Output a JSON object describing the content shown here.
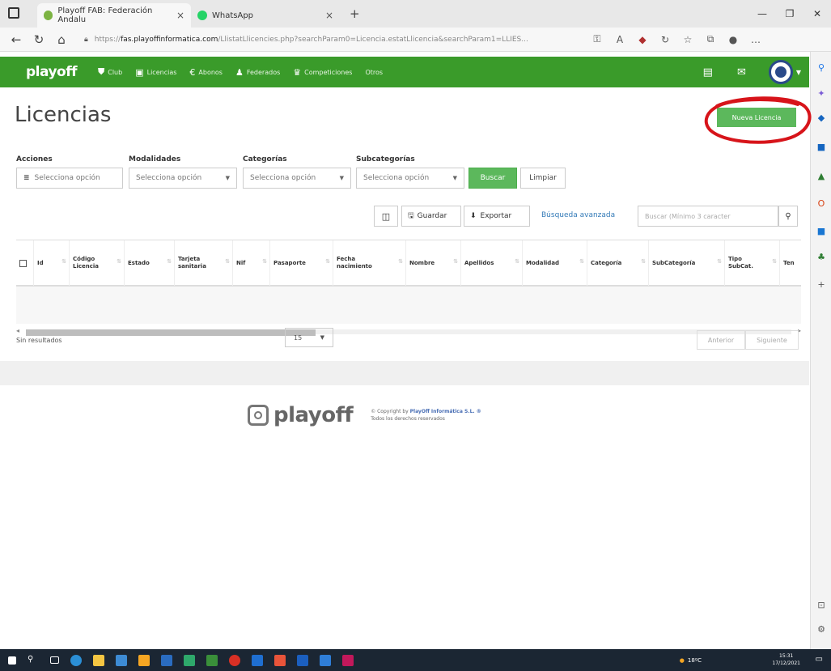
{
  "browser": {
    "tabs": [
      {
        "label": "Playoff FAB: Federación Andalu",
        "close": "×"
      },
      {
        "label": "WhatsApp",
        "close": "×"
      }
    ],
    "new_tab": "+",
    "url_prefix": "https://",
    "url_host": "fas.playoffinformatica.com",
    "url_path": "/LlistatLlicencies.php?searchParam0=Licencia.estatLlicencia&searchParam1=LLIES..."
  },
  "navbar": {
    "brand": "playoff",
    "items": [
      {
        "icon": "shield-icon",
        "label": "Club"
      },
      {
        "icon": "id-card-icon",
        "label": "Licencias"
      },
      {
        "icon": "euro-icon",
        "label": "Abonos"
      },
      {
        "icon": "person-icon",
        "label": "Federados"
      },
      {
        "icon": "trophy-icon",
        "label": "Competiciones"
      },
      {
        "icon": "",
        "label": "Otros"
      }
    ]
  },
  "page": {
    "title": "Licencias",
    "new_button": "Nueva Licencia"
  },
  "filters": {
    "acciones": {
      "label": "Acciones",
      "placeholder": "Selecciona opción"
    },
    "modalidades": {
      "label": "Modalidades",
      "placeholder": "Selecciona opción"
    },
    "categorias": {
      "label": "Categorías",
      "placeholder": "Selecciona opción"
    },
    "subcategorias": {
      "label": "Subcategorías",
      "placeholder": "Selecciona opción"
    },
    "buscar": "Buscar",
    "limpiar": "Limpiar"
  },
  "toolbar": {
    "guardar": "Guardar",
    "exportar": "Exportar",
    "busqueda_avanzada": "Búsqueda avanzada",
    "search_placeholder": "Buscar (Mínimo 3 caracter"
  },
  "table": {
    "columns": [
      "Id",
      "Código Licencia",
      "Estado",
      "Tarjeta sanitaria",
      "Nif",
      "Pasaporte",
      "Fecha nacimiento",
      "Nombre",
      "Apellidos",
      "Modalidad",
      "Categoría",
      "SubCategoría",
      "Tipo SubCat.",
      "Ten"
    ],
    "rows": []
  },
  "pagination": {
    "no_results": "Sin resultados",
    "page_size": "15",
    "prev": "Anterior",
    "next": "Siguiente"
  },
  "footer": {
    "logo": "playoff",
    "copyright_prefix": "© Copyright by ",
    "company": "PlayOff Informática S.L. ®",
    "rights": "Todos los derechos reservados"
  },
  "taskbar": {
    "weather": "18ºC",
    "time": "15:31",
    "date": "17/12/2021"
  },
  "colors": {
    "brand_green": "#3a9b2a",
    "button_green": "#5cb85c",
    "annotation_red": "#d7141a",
    "link_blue": "#337ab7"
  }
}
